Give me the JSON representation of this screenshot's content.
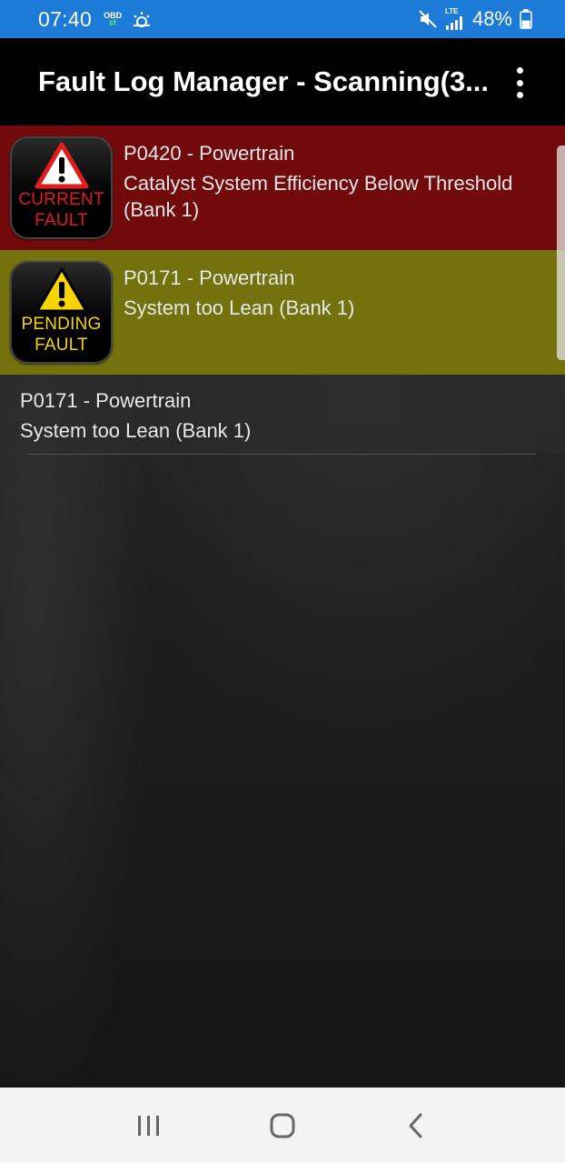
{
  "status_bar": {
    "time": "07:40",
    "obd_label": "OBD",
    "network_label": "LTE",
    "battery_percent": "48%",
    "battery_level": 0.48
  },
  "app_bar": {
    "title": "Fault Log Manager - Scanning(3..."
  },
  "faults": [
    {
      "badge_line1": "CURRENT",
      "badge_line2": "FAULT",
      "code": "P0420 - Powertrain",
      "description": "Catalyst System Efficiency Below Threshold (Bank 1)",
      "type": "current",
      "color": "#78080a"
    },
    {
      "badge_line1": "PENDING",
      "badge_line2": "FAULT",
      "code": "P0171 - Powertrain",
      "description": "System too Lean (Bank 1)",
      "type": "pending",
      "color": "#787610"
    },
    {
      "code": "P0171 - Powertrain",
      "description": "System too Lean (Bank 1)",
      "type": "stored"
    }
  ],
  "nav_bar": {
    "recent_icon": "recent-apps-icon",
    "home_icon": "home-icon",
    "back_icon": "back-icon"
  },
  "colors": {
    "status_bar": "#1c7bd6",
    "app_bar": "#000000",
    "current_fault": "#e01c1c",
    "pending_fault": "#f5d400"
  }
}
